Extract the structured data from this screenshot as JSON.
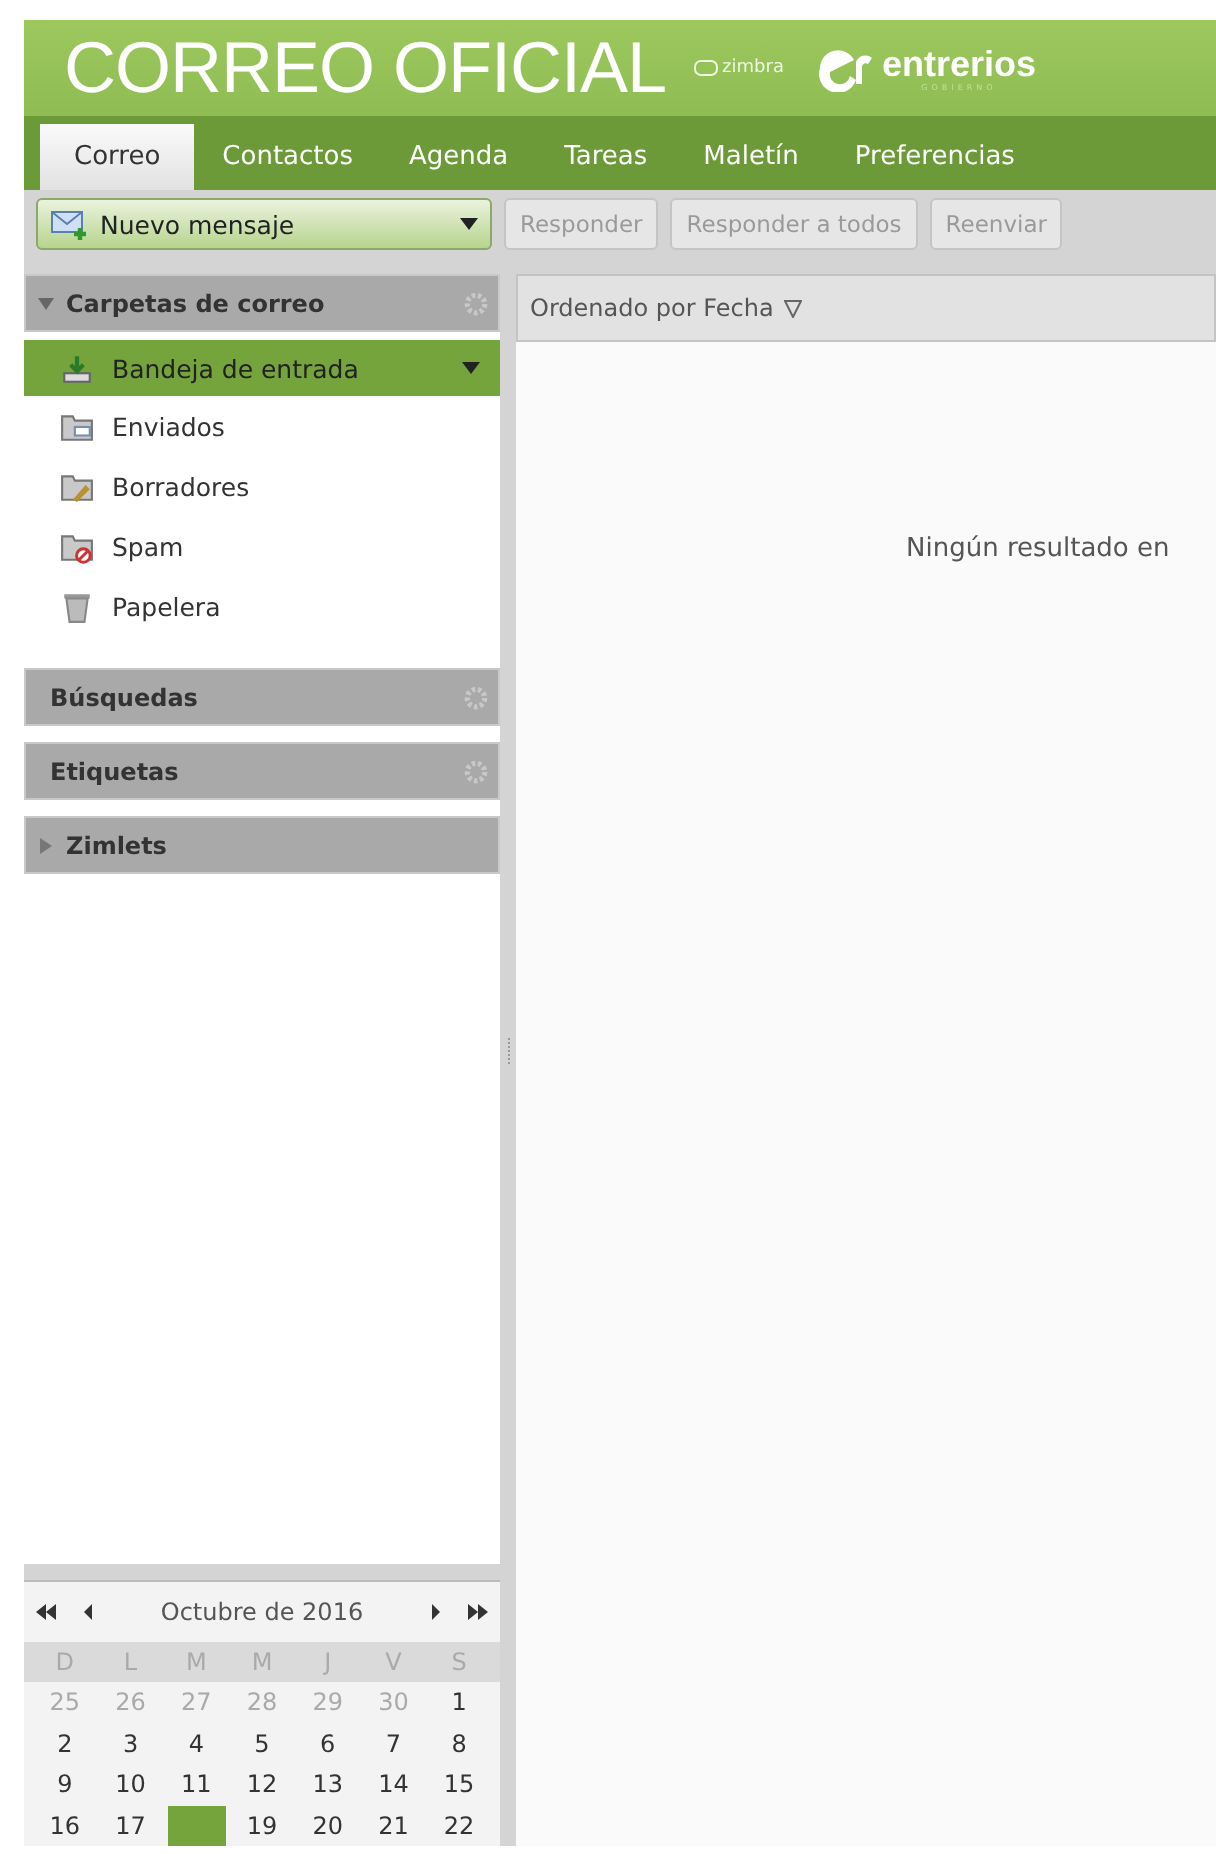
{
  "header": {
    "title": "CORREO OFICIAL",
    "zimbra": "zimbra",
    "brand": "entrerios",
    "brand_sub": "GOBIERNO"
  },
  "tabs": [
    {
      "label": "Correo",
      "selected": true
    },
    {
      "label": "Contactos",
      "selected": false
    },
    {
      "label": "Agenda",
      "selected": false
    },
    {
      "label": "Tareas",
      "selected": false
    },
    {
      "label": "Maletín",
      "selected": false
    },
    {
      "label": "Preferencias",
      "selected": false
    }
  ],
  "toolbar": {
    "new_message": "Nuevo mensaje",
    "buttons": [
      {
        "label": "Responder",
        "disabled": true
      },
      {
        "label": "Responder a todos",
        "disabled": true
      },
      {
        "label": "Reenviar",
        "disabled": true
      }
    ]
  },
  "folders": {
    "title": "Carpetas de correo",
    "expanded": true,
    "items": [
      {
        "label": "Bandeja de entrada",
        "kind": "inbox",
        "selected": true
      },
      {
        "label": "Enviados",
        "kind": "sent",
        "selected": false
      },
      {
        "label": "Borradores",
        "kind": "drafts",
        "selected": false
      },
      {
        "label": "Spam",
        "kind": "spam",
        "selected": false
      },
      {
        "label": "Papelera",
        "kind": "trash",
        "selected": false
      }
    ]
  },
  "sections": [
    {
      "title": "Búsquedas",
      "kind": "gear"
    },
    {
      "title": "Etiquetas",
      "kind": "gear"
    },
    {
      "title": "Zimlets",
      "kind": "collapsed"
    }
  ],
  "calendar": {
    "month": "Octubre de 2016",
    "weekdays": [
      "D",
      "L",
      "M",
      "M",
      "J",
      "V",
      "S"
    ],
    "weeks": [
      [
        {
          "day": "25",
          "other_month": true
        },
        {
          "day": "26",
          "other_month": true
        },
        {
          "day": "27",
          "other_month": true
        },
        {
          "day": "28",
          "other_month": true
        },
        {
          "day": "29",
          "other_month": true
        },
        {
          "day": "30",
          "other_month": true
        },
        {
          "day": "1",
          "other_month": false
        }
      ],
      [
        {
          "day": "2",
          "other_month": false
        },
        {
          "day": "3",
          "other_month": false
        },
        {
          "day": "4",
          "other_month": false
        },
        {
          "day": "5",
          "other_month": false
        },
        {
          "day": "6",
          "other_month": false
        },
        {
          "day": "7",
          "other_month": false
        },
        {
          "day": "8",
          "other_month": false
        }
      ],
      [
        {
          "day": "9",
          "other_month": false
        },
        {
          "day": "10",
          "other_month": false
        },
        {
          "day": "11",
          "other_month": false
        },
        {
          "day": "12",
          "other_month": false
        },
        {
          "day": "13",
          "other_month": false
        },
        {
          "day": "14",
          "other_month": false
        },
        {
          "day": "15",
          "other_month": false
        }
      ],
      [
        {
          "day": "16",
          "other_month": false,
          "selected": false
        },
        {
          "day": "17",
          "other_month": false,
          "selected": false
        },
        {
          "other_month": false,
          "selected": true
        },
        {
          "day": "19",
          "other_month": false,
          "selected": false
        },
        {
          "day": "20",
          "other_month": false,
          "selected": false
        },
        {
          "day": "21",
          "other_month": false,
          "selected": false
        },
        {
          "day": "22",
          "other_month": false,
          "selected": false
        }
      ]
    ]
  },
  "list": {
    "sort_label": "Ordenado por Fecha",
    "empty_message": "Ningún resultado en"
  }
}
